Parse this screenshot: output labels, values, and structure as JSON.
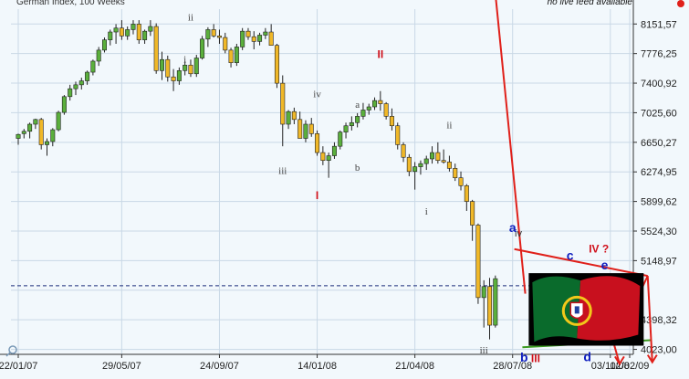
{
  "title": "German Index, 100 Weeks",
  "feed_note": "no live feed available",
  "colors": {
    "up": "#5aaf3c",
    "down": "#f0b828",
    "wick": "#222222",
    "trend": "#e0201a",
    "support": "#3a9a20",
    "reference": "#1a2a7a",
    "background": "#f2f8fc"
  },
  "chart_data": {
    "type": "candlestick",
    "title": "German Index, 100 Weeks",
    "y_ticks": [
      "8151,57",
      "7776,25",
      "7400,92",
      "7025,60",
      "6650,27",
      "6274,95",
      "5899,62",
      "5524,30",
      "5148,97",
      "",
      "4398,32",
      "4023,00"
    ],
    "ylim": [
      3960,
      8340
    ],
    "x_ticks": [
      "22/01/07",
      "29/05/07",
      "24/09/07",
      "14/01/08",
      "21/04/08",
      "28/07/08",
      "03/11/08",
      "02/02/09"
    ],
    "reference_line": 4830,
    "candles": [
      [
        6700,
        6760,
        6620,
        6750
      ],
      [
        6760,
        6820,
        6700,
        6790
      ],
      [
        6790,
        6900,
        6700,
        6880
      ],
      [
        6880,
        6950,
        6820,
        6940
      ],
      [
        6940,
        6960,
        6560,
        6620
      ],
      [
        6620,
        6700,
        6480,
        6660
      ],
      [
        6660,
        6830,
        6600,
        6810
      ],
      [
        6810,
        7050,
        6790,
        7030
      ],
      [
        7030,
        7250,
        7000,
        7230
      ],
      [
        7230,
        7380,
        7180,
        7330
      ],
      [
        7330,
        7420,
        7250,
        7380
      ],
      [
        7380,
        7470,
        7320,
        7430
      ],
      [
        7430,
        7560,
        7380,
        7540
      ],
      [
        7540,
        7700,
        7500,
        7680
      ],
      [
        7680,
        7860,
        7620,
        7820
      ],
      [
        7820,
        7980,
        7790,
        7950
      ],
      [
        7950,
        8080,
        7880,
        8050
      ],
      [
        8050,
        8150,
        7900,
        8100
      ],
      [
        8100,
        8200,
        7950,
        8000
      ],
      [
        8000,
        8120,
        7950,
        8080
      ],
      [
        8080,
        8200,
        8020,
        8150
      ],
      [
        8150,
        8200,
        7900,
        7950
      ],
      [
        7950,
        8080,
        7900,
        8060
      ],
      [
        8060,
        8200,
        8000,
        8120
      ],
      [
        8120,
        8160,
        7520,
        7560
      ],
      [
        7560,
        7800,
        7440,
        7700
      ],
      [
        7700,
        7750,
        7420,
        7480
      ],
      [
        7480,
        7580,
        7300,
        7430
      ],
      [
        7430,
        7600,
        7380,
        7560
      ],
      [
        7560,
        7680,
        7500,
        7630
      ],
      [
        7630,
        7700,
        7480,
        7520
      ],
      [
        7520,
        7760,
        7480,
        7720
      ],
      [
        7720,
        8000,
        7700,
        7960
      ],
      [
        7960,
        8110,
        7860,
        8080
      ],
      [
        8080,
        8150,
        7980,
        8000
      ],
      [
        8000,
        8080,
        7900,
        7980
      ],
      [
        7980,
        8040,
        7780,
        7820
      ],
      [
        7820,
        7850,
        7600,
        7660
      ],
      [
        7660,
        7900,
        7620,
        7860
      ],
      [
        7860,
        8100,
        7820,
        8060
      ],
      [
        8060,
        8100,
        7950,
        7990
      ],
      [
        7990,
        8060,
        7830,
        7930
      ],
      [
        7930,
        8040,
        7880,
        8010
      ],
      [
        8010,
        8100,
        7960,
        8050
      ],
      [
        8050,
        8150,
        7980,
        7880
      ],
      [
        7880,
        7900,
        7340,
        7400
      ],
      [
        7400,
        7500,
        6600,
        6880
      ],
      [
        6880,
        7060,
        6820,
        7040
      ],
      [
        7040,
        7090,
        6880,
        6940
      ],
      [
        6940,
        7040,
        6700,
        6700
      ],
      [
        6700,
        6930,
        6650,
        6880
      ],
      [
        6880,
        6960,
        6720,
        6760
      ],
      [
        6760,
        6800,
        6480,
        6520
      ],
      [
        6520,
        6600,
        6360,
        6420
      ],
      [
        6420,
        6520,
        6200,
        6480
      ],
      [
        6480,
        6650,
        6440,
        6600
      ],
      [
        6600,
        6800,
        6560,
        6780
      ],
      [
        6780,
        6900,
        6700,
        6860
      ],
      [
        6860,
        6980,
        6800,
        6900
      ],
      [
        6900,
        7020,
        6840,
        6980
      ],
      [
        6980,
        7150,
        6940,
        7060
      ],
      [
        7060,
        7140,
        7000,
        7100
      ],
      [
        7100,
        7220,
        7060,
        7180
      ],
      [
        7180,
        7300,
        7050,
        7140
      ],
      [
        7140,
        7160,
        6940,
        6980
      ],
      [
        6980,
        7080,
        6800,
        6860
      ],
      [
        6860,
        6900,
        6560,
        6620
      ],
      [
        6620,
        6650,
        6400,
        6460
      ],
      [
        6460,
        6500,
        6220,
        6280
      ],
      [
        6280,
        6400,
        6050,
        6340
      ],
      [
        6340,
        6420,
        6240,
        6380
      ],
      [
        6380,
        6480,
        6300,
        6440
      ],
      [
        6440,
        6600,
        6380,
        6520
      ],
      [
        6520,
        6650,
        6380,
        6420
      ],
      [
        6420,
        6560,
        6380,
        6400
      ],
      [
        6400,
        6480,
        6280,
        6320
      ],
      [
        6320,
        6380,
        6160,
        6200
      ],
      [
        6200,
        6280,
        6040,
        6100
      ],
      [
        6100,
        6120,
        5780,
        5900
      ],
      [
        5900,
        5920,
        5400,
        5600
      ],
      [
        5600,
        5620,
        4600,
        4680
      ],
      [
        4680,
        4900,
        4300,
        4820
      ],
      [
        4820,
        4930,
        4150,
        4330
      ],
      [
        4330,
        4960,
        4300,
        4920
      ]
    ]
  },
  "waves": [
    {
      "text": "ii",
      "style": "wave",
      "i": 30,
      "v": 8195
    },
    {
      "text": "i",
      "style": "wave",
      "i": 29,
      "v": 7660
    },
    {
      "text": "iii",
      "style": "wave",
      "i": 46,
      "v": 6250
    },
    {
      "text": "iv",
      "style": "wave",
      "i": 52,
      "v": 7220
    },
    {
      "text": "a",
      "style": "wave",
      "i": 59,
      "v": 7090
    },
    {
      "text": "b",
      "style": "wave",
      "i": 59,
      "v": 6290
    },
    {
      "text": "I",
      "style": "wave-red",
      "i": 52,
      "v": 5930
    },
    {
      "text": "II",
      "style": "wave-red",
      "i": 63,
      "v": 7720
    },
    {
      "text": "ii",
      "style": "wave",
      "i": 75,
      "v": 6830
    },
    {
      "text": "i",
      "style": "wave",
      "i": 71,
      "v": 5735
    },
    {
      "text": "iii",
      "style": "wave",
      "i": 81,
      "v": 3970
    },
    {
      "text": "iv",
      "style": "wave-dark",
      "i": 87,
      "v": 5455
    },
    {
      "text": "a",
      "style": "wave-blue",
      "i": 86,
      "v": 5515
    },
    {
      "text": "c",
      "style": "wave-blue",
      "i": 96,
      "v": 5160
    },
    {
      "text": "IV ?",
      "style": "wave-red",
      "i": 101,
      "v": 5250
    },
    {
      "text": "e",
      "style": "wave-blue",
      "i": 102,
      "v": 5035
    },
    {
      "text": "b",
      "style": "wave-blue",
      "i": 88,
      "v": 3865
    },
    {
      "text": "III",
      "style": "wave-red",
      "i": 90,
      "v": 3860
    },
    {
      "text": "d",
      "style": "wave-blue",
      "i": 99,
      "v": 3875
    }
  ],
  "trendlines": [
    {
      "name": "upper-fan-line",
      "color": "trend",
      "from": [
        82.3,
        9050
      ],
      "to": [
        88.2,
        4730
      ]
    },
    {
      "name": "triangle-upper-line",
      "color": "trend",
      "from": [
        86.3,
        5295
      ],
      "to": [
        109.5,
        4955
      ]
    },
    {
      "name": "triangle-lower-line",
      "color": "support",
      "from": [
        87.7,
        4050
      ],
      "to": [
        110,
        4140
      ]
    },
    {
      "name": "extension-right-down",
      "color": "trend",
      "from": [
        109.5,
        4955
      ],
      "to": [
        110.3,
        3860
      ]
    },
    {
      "name": "extension-down-tick",
      "color": "trend",
      "from": [
        102,
        4510
      ],
      "to": [
        104.6,
        3840
      ]
    },
    {
      "name": "extension-mid-tick",
      "color": "trend",
      "from": [
        108.5,
        4800
      ],
      "to": [
        109.5,
        4955
      ]
    }
  ]
}
